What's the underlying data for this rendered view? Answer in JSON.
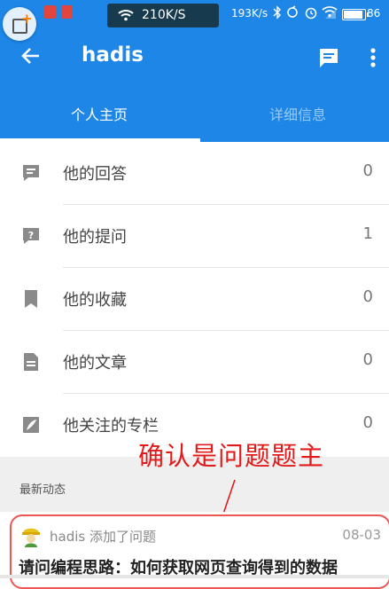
{
  "status_bar": {
    "speed_pill": "210K/S",
    "speed_secondary": "193K/s",
    "battery": "86"
  },
  "app_bar": {
    "title": "hadis",
    "icons": {
      "back": "arrow-back-icon",
      "message": "chat-icon",
      "more": "more-vert-icon"
    }
  },
  "tabs": [
    {
      "label": "个人主页",
      "active": true
    },
    {
      "label": "详细信息",
      "active": false
    }
  ],
  "list": [
    {
      "icon": "answer-icon",
      "label": "他的回答",
      "count": "0"
    },
    {
      "icon": "question-icon",
      "label": "他的提问",
      "count": "1"
    },
    {
      "icon": "bookmark-icon",
      "label": "他的收藏",
      "count": "0"
    },
    {
      "icon": "article-icon",
      "label": "他的文章",
      "count": "0"
    },
    {
      "icon": "column-icon",
      "label": "他关注的专栏",
      "count": "0"
    }
  ],
  "section_title": "最新动态",
  "annotation": "确认是问题题主",
  "feed": {
    "author_action": "hadis 添加了问题",
    "date": "08-03",
    "title": "请问编程思路：如何获取网页查询得到的数据"
  },
  "colors": {
    "primary": "#1d86e6",
    "annotation": "#e11b1b",
    "section_bg": "#efefef"
  }
}
